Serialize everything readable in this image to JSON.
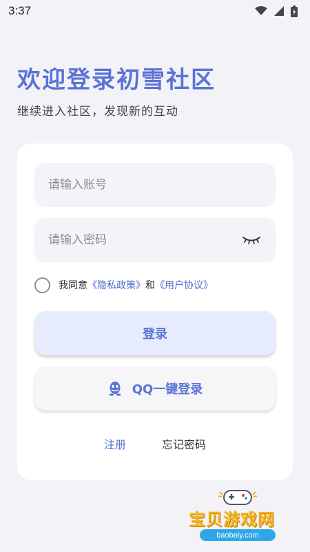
{
  "status_bar": {
    "time": "3:37",
    "icons": [
      "wifi-icon",
      "signal-icon",
      "battery-icon"
    ]
  },
  "header": {
    "title": "欢迎登录初雪社区",
    "subtitle": "继续进入社区，发现新的互动"
  },
  "form": {
    "account_placeholder": "请输入账号",
    "account_value": "",
    "password_placeholder": "请输入密码",
    "password_value": "",
    "agreement": {
      "checked": false,
      "prefix": "我同意",
      "privacy_link": "《隐私政策》",
      "conjunction": "和",
      "terms_link": "《用户协议》"
    },
    "login_label": "登录",
    "qq_login_label": "QQ一键登录",
    "register_label": "注册",
    "forgot_label": "忘记密码"
  },
  "watermark": {
    "name": "宝贝游戏网",
    "url": "baobeiy.com"
  },
  "colors": {
    "accent": "#5b73d6",
    "link": "#4f6dd1",
    "background": "#f3f3f7",
    "card": "#ffffff",
    "field": "#f3f4f8",
    "login_button": "#e6ecfd"
  }
}
